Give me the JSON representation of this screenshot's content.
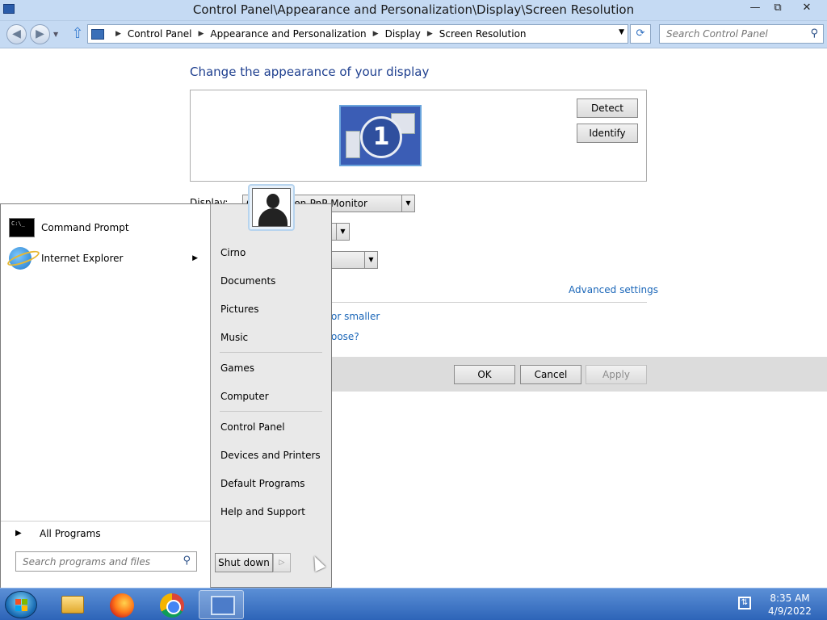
{
  "window": {
    "title": "Control Panel\\Appearance and Personalization\\Display\\Screen Resolution",
    "minimize": "—",
    "restore": "⧉",
    "close": "✕"
  },
  "address": {
    "crumbs": [
      "Control Panel",
      "Appearance and Personalization",
      "Display",
      "Screen Resolution"
    ],
    "search_placeholder": "Search Control Panel"
  },
  "content": {
    "heading": "Change the appearance of your display",
    "monitor_number": "1",
    "detect_label": "Detect",
    "identify_label": "Identify",
    "display_label": "Display:",
    "display_value": "Generic Non-PnP Monitor",
    "advanced_link": "Advanced settings",
    "link_smaller": "or smaller",
    "link_choose": "oose?",
    "ok_label": "OK",
    "cancel_label": "Cancel",
    "apply_label": "Apply"
  },
  "start_menu": {
    "pinned": [
      {
        "label": "Command Prompt",
        "icon": "command-prompt-icon"
      },
      {
        "label": "Internet Explorer",
        "icon": "internet-explorer-icon"
      }
    ],
    "all_programs": "All Programs",
    "search_placeholder": "Search programs and files",
    "right_items": [
      "Cirno",
      "Documents",
      "Pictures",
      "Music",
      "Games",
      "Computer",
      "Control Panel",
      "Devices and Printers",
      "Default Programs",
      "Help and Support"
    ],
    "shutdown_label": "Shut down"
  },
  "taskbar": {
    "apps": [
      "windows-explorer-icon",
      "firefox-icon",
      "chrome-icon",
      "control-panel-icon"
    ],
    "time": "8:35 AM",
    "date": "4/9/2022"
  },
  "colors": {
    "chrome": "#c5daf3",
    "heading": "#1e3f8f",
    "link": "#1a66b8",
    "taskbar": "#2d64b8"
  }
}
